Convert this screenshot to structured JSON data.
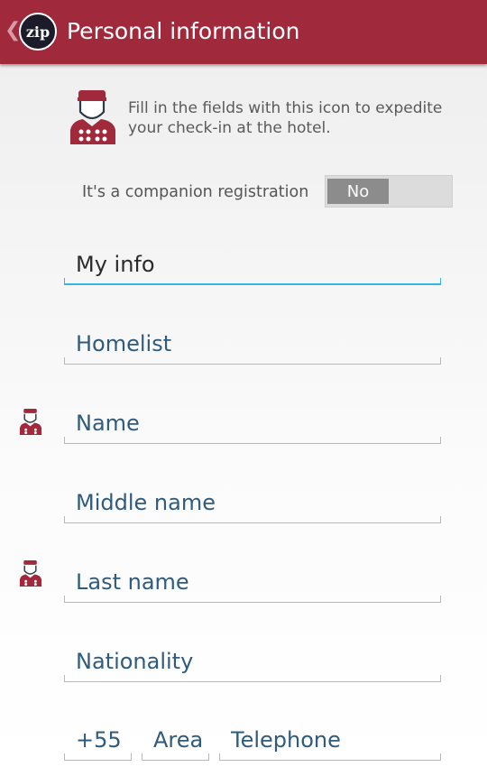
{
  "header": {
    "title": "Personal information",
    "logo_text": "zip",
    "back_glyph": "❮",
    "background": "#a02a3c"
  },
  "info": {
    "text": "Fill in the fields with this icon to expedite your check-in at the hotel.",
    "icon": "bellhop-icon"
  },
  "companion": {
    "label": "It's a companion registration",
    "toggle_value": "No"
  },
  "fields": {
    "my_info": "My info",
    "homelist": "Homelist",
    "name": "Name",
    "middle_name": "Middle name",
    "last_name": "Last name",
    "nationality": "Nationality",
    "country_code": "+55",
    "area": "Area",
    "telephone": "Telephone"
  },
  "colors": {
    "accent_focus": "#33b5e5",
    "hint_text": "#2e5b7e",
    "icon_red": "#a02a3c"
  }
}
